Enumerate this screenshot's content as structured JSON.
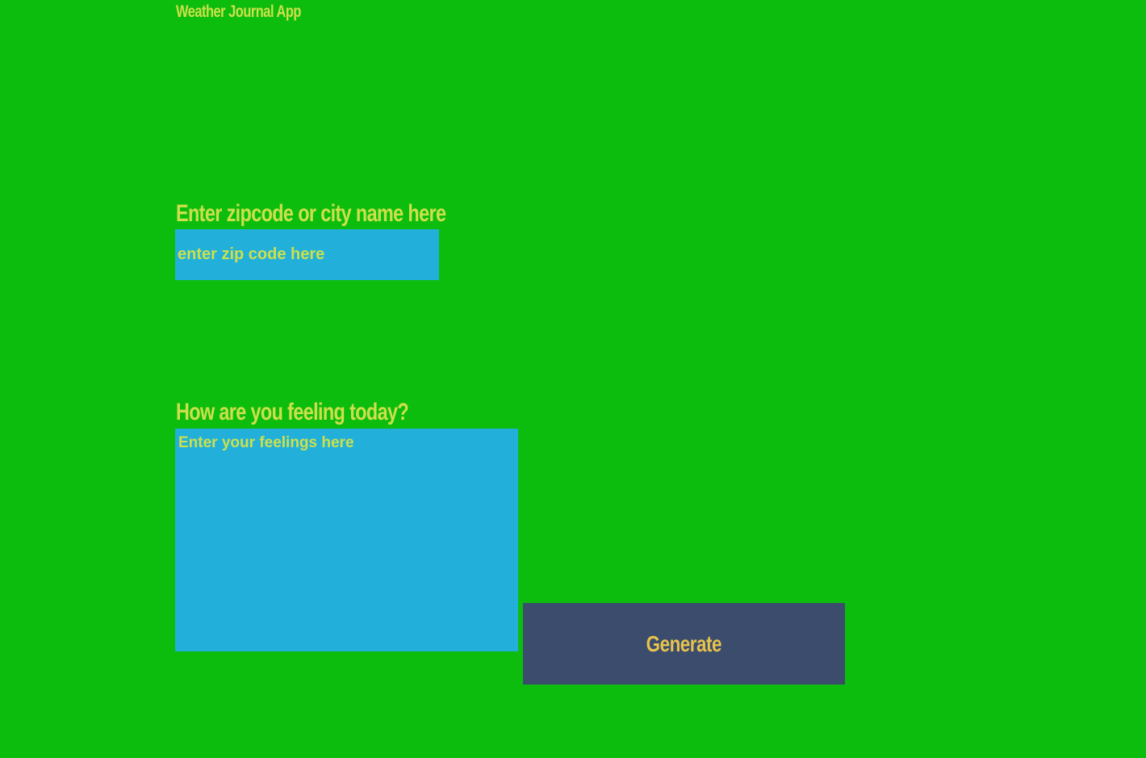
{
  "app": {
    "title": "Weather Journal App"
  },
  "zip": {
    "label": "Enter zipcode or city name here",
    "value": "",
    "placeholder": "enter zip code here"
  },
  "feelings": {
    "label": "How are you feeling today?",
    "value": "",
    "placeholder": "Enter your feelings here"
  },
  "actions": {
    "generate_label": "Generate"
  },
  "colors": {
    "background": "#0cbd0e",
    "input_background": "#22b0db",
    "text": "#cde04a",
    "button_background": "#3b4c6c",
    "button_text": "#e7c24d"
  }
}
